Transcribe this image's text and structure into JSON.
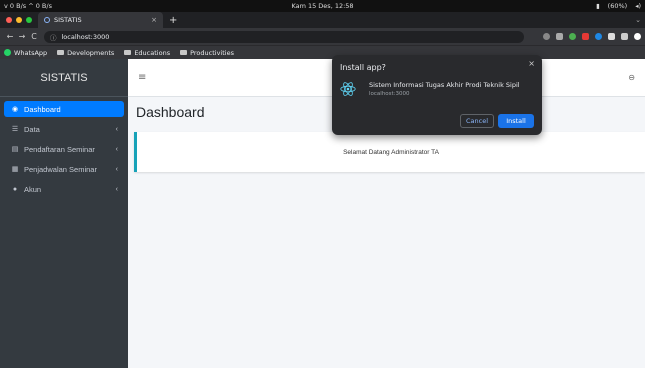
{
  "os": {
    "net": "v 0 B/s ^ 0 B/s",
    "clock": "Kam 15 Des, 12:58",
    "battery": "(60%)"
  },
  "browser": {
    "tab_title": "SISTATIS",
    "tab_close": "×",
    "new_tab": "+",
    "url": "localhost:3000",
    "bookmarks": [
      {
        "label": "WhatsApp"
      },
      {
        "label": "Developments"
      },
      {
        "label": "Educations"
      },
      {
        "label": "Productivities"
      }
    ]
  },
  "app": {
    "brand": "SISTATIS",
    "page_title": "Dashboard",
    "welcome": "Selamat Datang Administrator TA",
    "nav": [
      {
        "label": "Dashboard",
        "icon": "dashboard-icon"
      },
      {
        "label": "Data",
        "icon": "list-icon"
      },
      {
        "label": "Pendaftaran Seminar",
        "icon": "file-icon"
      },
      {
        "label": "Penjadwalan Seminar",
        "icon": "calendar-icon"
      },
      {
        "label": "Akun",
        "icon": "user-icon"
      }
    ]
  },
  "install_dialog": {
    "title": "Install app?",
    "close": "×",
    "app_name": "Sistem Informasi Tugas Akhir Prodi Teknik Sipil",
    "app_url": "localhost:3000",
    "cancel": "Cancel",
    "install": "Install"
  },
  "colors": {
    "sidebar": "#343a40",
    "active": "#007bff",
    "install_button": "#1a73e8",
    "callout_border": "#17a2b8"
  }
}
